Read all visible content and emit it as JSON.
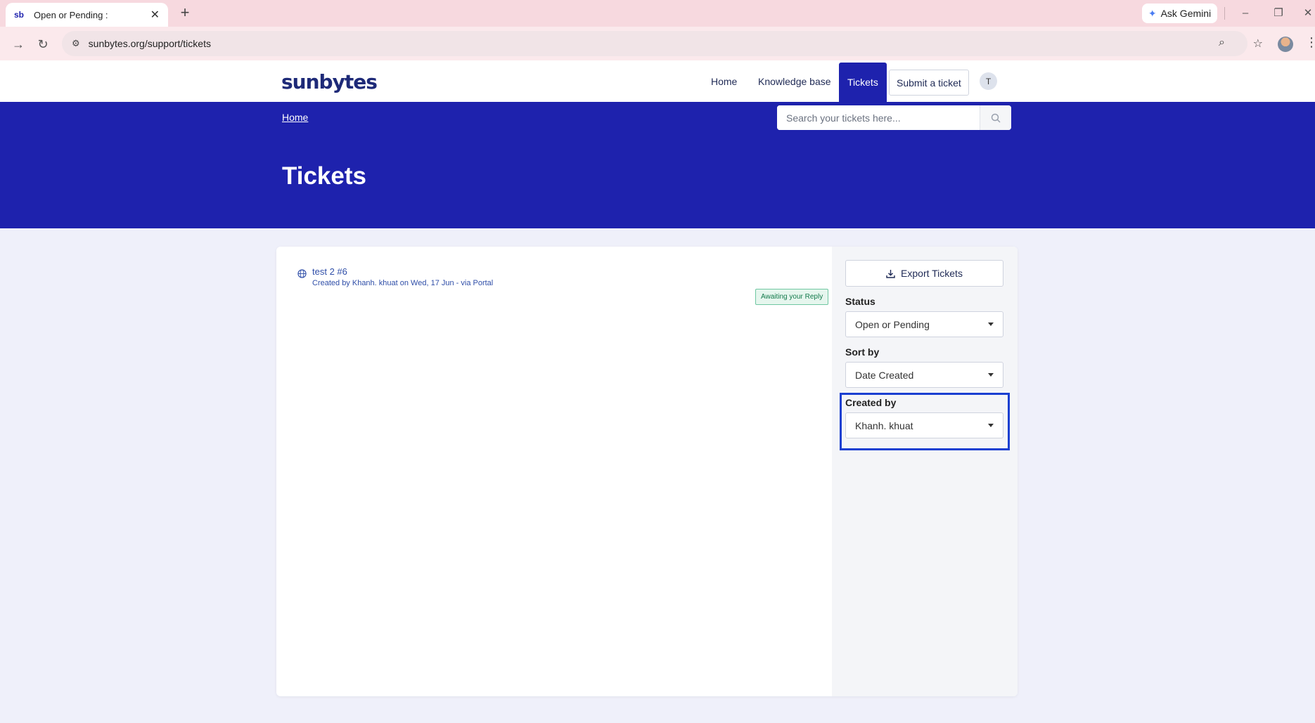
{
  "browser": {
    "tab_favicon": "sb",
    "tab_title": "Open or Pending :",
    "tab_close": "✕",
    "new_tab": "+",
    "gemini_label": "Ask Gemini",
    "url": "sunbytes.org/support/tickets",
    "icons": [
      "back-arrow-icon",
      "reload-icon",
      "site-settings-icon",
      "zoom-icon",
      "star-icon",
      "profile-avatar",
      "kebab-menu-icon"
    ]
  },
  "header": {
    "logo": "sunbytes",
    "nav": {
      "home": "Home",
      "knowledge_base": "Knowledge base",
      "tickets": "Tickets"
    },
    "submit_ticket": "Submit a ticket",
    "user_initial": "T"
  },
  "hero": {
    "breadcrumb": "Home",
    "search_placeholder": "Search your tickets here...",
    "title": "Tickets"
  },
  "tickets": [
    {
      "title": "test 2 #6",
      "meta": "Created by Khanh. khuat on Wed, 17 Jun - via Portal",
      "status_badge": "Awaiting your Reply"
    }
  ],
  "sidebar": {
    "export_label": "Export Tickets",
    "status": {
      "label": "Status",
      "selected": "Open or Pending"
    },
    "sort_by": {
      "label": "Sort by",
      "selected": "Date Created"
    },
    "created_by": {
      "label": "Created by",
      "selected": "Khanh. khuat"
    }
  },
  "colors": {
    "brand": "#1e22ad",
    "badge_green": "#137a4b",
    "highlight": "#1a3fd1"
  }
}
